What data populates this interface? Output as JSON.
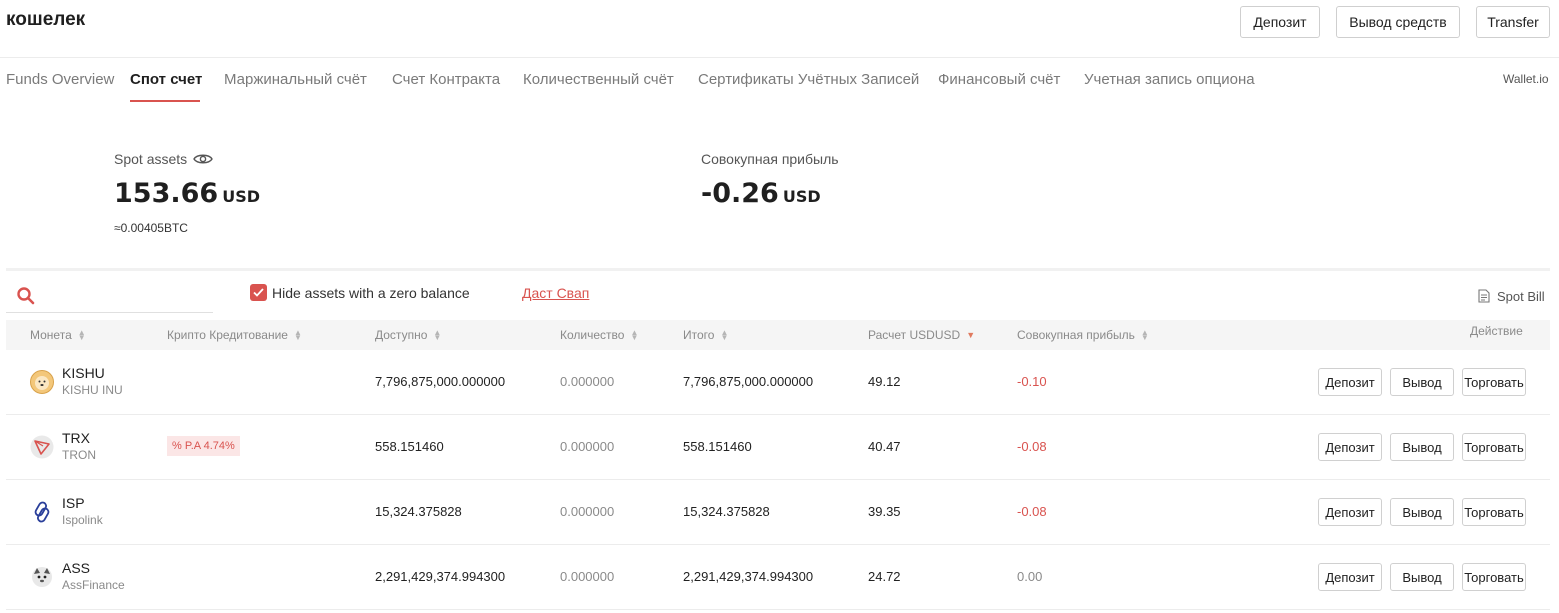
{
  "header": {
    "title": "кошелек",
    "buttons": {
      "deposit": "Депозит",
      "withdraw": "Вывод средств",
      "transfer": "Transfer"
    }
  },
  "tabs": [
    {
      "label": "Funds Overview",
      "active": false
    },
    {
      "label": "Спот счет",
      "active": true
    },
    {
      "label": "Маржинальный счёт",
      "active": false
    },
    {
      "label": "Счет Контракта",
      "active": false
    },
    {
      "label": "Количественный счёт",
      "active": false
    },
    {
      "label": "Сертификаты Учётных Записей",
      "active": false
    },
    {
      "label": "Финансовый счёт",
      "active": false
    },
    {
      "label": "Учетная запись опциона",
      "active": false
    }
  ],
  "wallet_link": "Wallet.io",
  "summary": {
    "spot_label": "Spot assets",
    "spot_value": "153.66",
    "spot_unit": "USD",
    "btc_equiv": "≈0.00405BTC",
    "profit_label": "Совокупная прибыль",
    "profit_value": "-0.26",
    "profit_unit": "USD"
  },
  "toolbar": {
    "search_placeholder": "",
    "hide_zero_label": "Hide assets with a zero balance",
    "hide_zero_checked": true,
    "swap_link": "Даст Свап",
    "spot_bill": "Spot Bill"
  },
  "table": {
    "headers": {
      "coin": "Монета",
      "credit": "Крипто Кредитование",
      "available": "Доступно",
      "quantity": "Количество",
      "total": "Итого",
      "calc": "Расчет USDUSD",
      "profit": "Совокупная прибыль",
      "action": "Действие"
    },
    "rows": [
      {
        "symbol": "KISHU",
        "name": "KISHU INU",
        "icon": "kishu-icon",
        "badge": "",
        "available": "7,796,875,000.000000",
        "quantity": "0.000000",
        "total": "7,796,875,000.000000",
        "calc": "49.12",
        "profit": "-0.10",
        "negative": true
      },
      {
        "symbol": "TRX",
        "name": "TRON",
        "icon": "tron-icon",
        "badge": "% P.A 4.74%",
        "available": "558.151460",
        "quantity": "0.000000",
        "total": "558.151460",
        "calc": "40.47",
        "profit": "-0.08",
        "negative": true
      },
      {
        "symbol": "ISP",
        "name": "Ispolink",
        "icon": "ispolink-icon",
        "badge": "",
        "available": "15,324.375828",
        "quantity": "0.000000",
        "total": "15,324.375828",
        "calc": "39.35",
        "profit": "-0.08",
        "negative": true
      },
      {
        "symbol": "ASS",
        "name": "AssFinance",
        "icon": "assfinance-icon",
        "badge": "",
        "available": "2,291,429,374.994300",
        "quantity": "0.000000",
        "total": "2,291,429,374.994300",
        "calc": "24.72",
        "profit": "0.00",
        "negative": false
      }
    ],
    "row_buttons": {
      "deposit": "Депозит",
      "withdraw": "Вывод",
      "trade": "Торговать"
    }
  },
  "colors": {
    "accent": "#d9534f",
    "negative": "#d9534f",
    "muted": "#8a8a8a"
  }
}
